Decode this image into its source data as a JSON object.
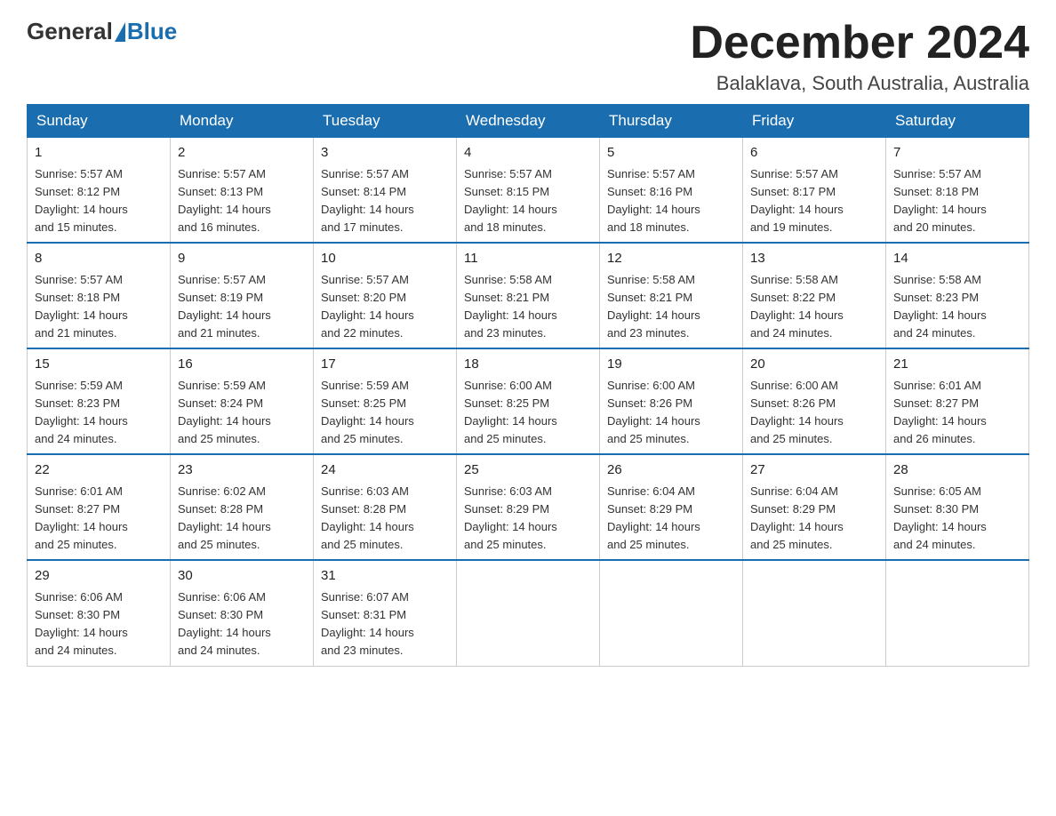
{
  "header": {
    "logo_general": "General",
    "logo_blue": "Blue",
    "month_title": "December 2024",
    "location": "Balaklava, South Australia, Australia"
  },
  "weekdays": [
    "Sunday",
    "Monday",
    "Tuesday",
    "Wednesday",
    "Thursday",
    "Friday",
    "Saturday"
  ],
  "weeks": [
    [
      {
        "day": "1",
        "sunrise": "5:57 AM",
        "sunset": "8:12 PM",
        "daylight": "14 hours and 15 minutes."
      },
      {
        "day": "2",
        "sunrise": "5:57 AM",
        "sunset": "8:13 PM",
        "daylight": "14 hours and 16 minutes."
      },
      {
        "day": "3",
        "sunrise": "5:57 AM",
        "sunset": "8:14 PM",
        "daylight": "14 hours and 17 minutes."
      },
      {
        "day": "4",
        "sunrise": "5:57 AM",
        "sunset": "8:15 PM",
        "daylight": "14 hours and 18 minutes."
      },
      {
        "day": "5",
        "sunrise": "5:57 AM",
        "sunset": "8:16 PM",
        "daylight": "14 hours and 18 minutes."
      },
      {
        "day": "6",
        "sunrise": "5:57 AM",
        "sunset": "8:17 PM",
        "daylight": "14 hours and 19 minutes."
      },
      {
        "day": "7",
        "sunrise": "5:57 AM",
        "sunset": "8:18 PM",
        "daylight": "14 hours and 20 minutes."
      }
    ],
    [
      {
        "day": "8",
        "sunrise": "5:57 AM",
        "sunset": "8:18 PM",
        "daylight": "14 hours and 21 minutes."
      },
      {
        "day": "9",
        "sunrise": "5:57 AM",
        "sunset": "8:19 PM",
        "daylight": "14 hours and 21 minutes."
      },
      {
        "day": "10",
        "sunrise": "5:57 AM",
        "sunset": "8:20 PM",
        "daylight": "14 hours and 22 minutes."
      },
      {
        "day": "11",
        "sunrise": "5:58 AM",
        "sunset": "8:21 PM",
        "daylight": "14 hours and 23 minutes."
      },
      {
        "day": "12",
        "sunrise": "5:58 AM",
        "sunset": "8:21 PM",
        "daylight": "14 hours and 23 minutes."
      },
      {
        "day": "13",
        "sunrise": "5:58 AM",
        "sunset": "8:22 PM",
        "daylight": "14 hours and 24 minutes."
      },
      {
        "day": "14",
        "sunrise": "5:58 AM",
        "sunset": "8:23 PM",
        "daylight": "14 hours and 24 minutes."
      }
    ],
    [
      {
        "day": "15",
        "sunrise": "5:59 AM",
        "sunset": "8:23 PM",
        "daylight": "14 hours and 24 minutes."
      },
      {
        "day": "16",
        "sunrise": "5:59 AM",
        "sunset": "8:24 PM",
        "daylight": "14 hours and 25 minutes."
      },
      {
        "day": "17",
        "sunrise": "5:59 AM",
        "sunset": "8:25 PM",
        "daylight": "14 hours and 25 minutes."
      },
      {
        "day": "18",
        "sunrise": "6:00 AM",
        "sunset": "8:25 PM",
        "daylight": "14 hours and 25 minutes."
      },
      {
        "day": "19",
        "sunrise": "6:00 AM",
        "sunset": "8:26 PM",
        "daylight": "14 hours and 25 minutes."
      },
      {
        "day": "20",
        "sunrise": "6:00 AM",
        "sunset": "8:26 PM",
        "daylight": "14 hours and 25 minutes."
      },
      {
        "day": "21",
        "sunrise": "6:01 AM",
        "sunset": "8:27 PM",
        "daylight": "14 hours and 26 minutes."
      }
    ],
    [
      {
        "day": "22",
        "sunrise": "6:01 AM",
        "sunset": "8:27 PM",
        "daylight": "14 hours and 25 minutes."
      },
      {
        "day": "23",
        "sunrise": "6:02 AM",
        "sunset": "8:28 PM",
        "daylight": "14 hours and 25 minutes."
      },
      {
        "day": "24",
        "sunrise": "6:03 AM",
        "sunset": "8:28 PM",
        "daylight": "14 hours and 25 minutes."
      },
      {
        "day": "25",
        "sunrise": "6:03 AM",
        "sunset": "8:29 PM",
        "daylight": "14 hours and 25 minutes."
      },
      {
        "day": "26",
        "sunrise": "6:04 AM",
        "sunset": "8:29 PM",
        "daylight": "14 hours and 25 minutes."
      },
      {
        "day": "27",
        "sunrise": "6:04 AM",
        "sunset": "8:29 PM",
        "daylight": "14 hours and 25 minutes."
      },
      {
        "day": "28",
        "sunrise": "6:05 AM",
        "sunset": "8:30 PM",
        "daylight": "14 hours and 24 minutes."
      }
    ],
    [
      {
        "day": "29",
        "sunrise": "6:06 AM",
        "sunset": "8:30 PM",
        "daylight": "14 hours and 24 minutes."
      },
      {
        "day": "30",
        "sunrise": "6:06 AM",
        "sunset": "8:30 PM",
        "daylight": "14 hours and 24 minutes."
      },
      {
        "day": "31",
        "sunrise": "6:07 AM",
        "sunset": "8:31 PM",
        "daylight": "14 hours and 23 minutes."
      },
      null,
      null,
      null,
      null
    ]
  ],
  "labels": {
    "sunrise_prefix": "Sunrise: ",
    "sunset_prefix": "Sunset: ",
    "daylight_prefix": "Daylight: "
  }
}
